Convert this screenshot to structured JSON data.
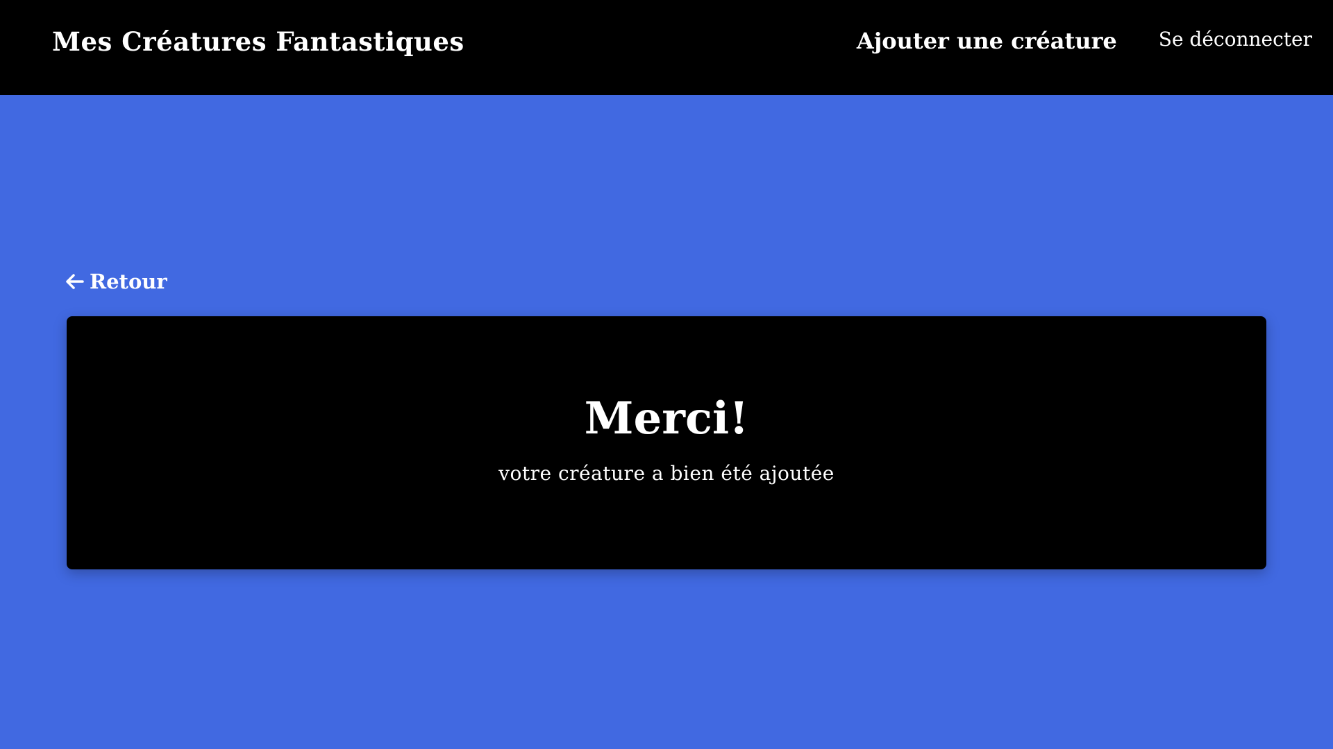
{
  "header": {
    "brand": "Mes Créatures Fantastiques",
    "nav": {
      "add_creature": "Ajouter une créature",
      "logout": "Se déconnecter"
    }
  },
  "main": {
    "back_label": "Retour",
    "card": {
      "title": "Merci!",
      "message": "votre créature a bien été ajoutée"
    }
  },
  "icons": {
    "back": "arrow-left-icon"
  },
  "colors": {
    "page_background": "#4169E1",
    "header_background": "#000000",
    "card_background": "#000000",
    "text": "#ffffff"
  }
}
